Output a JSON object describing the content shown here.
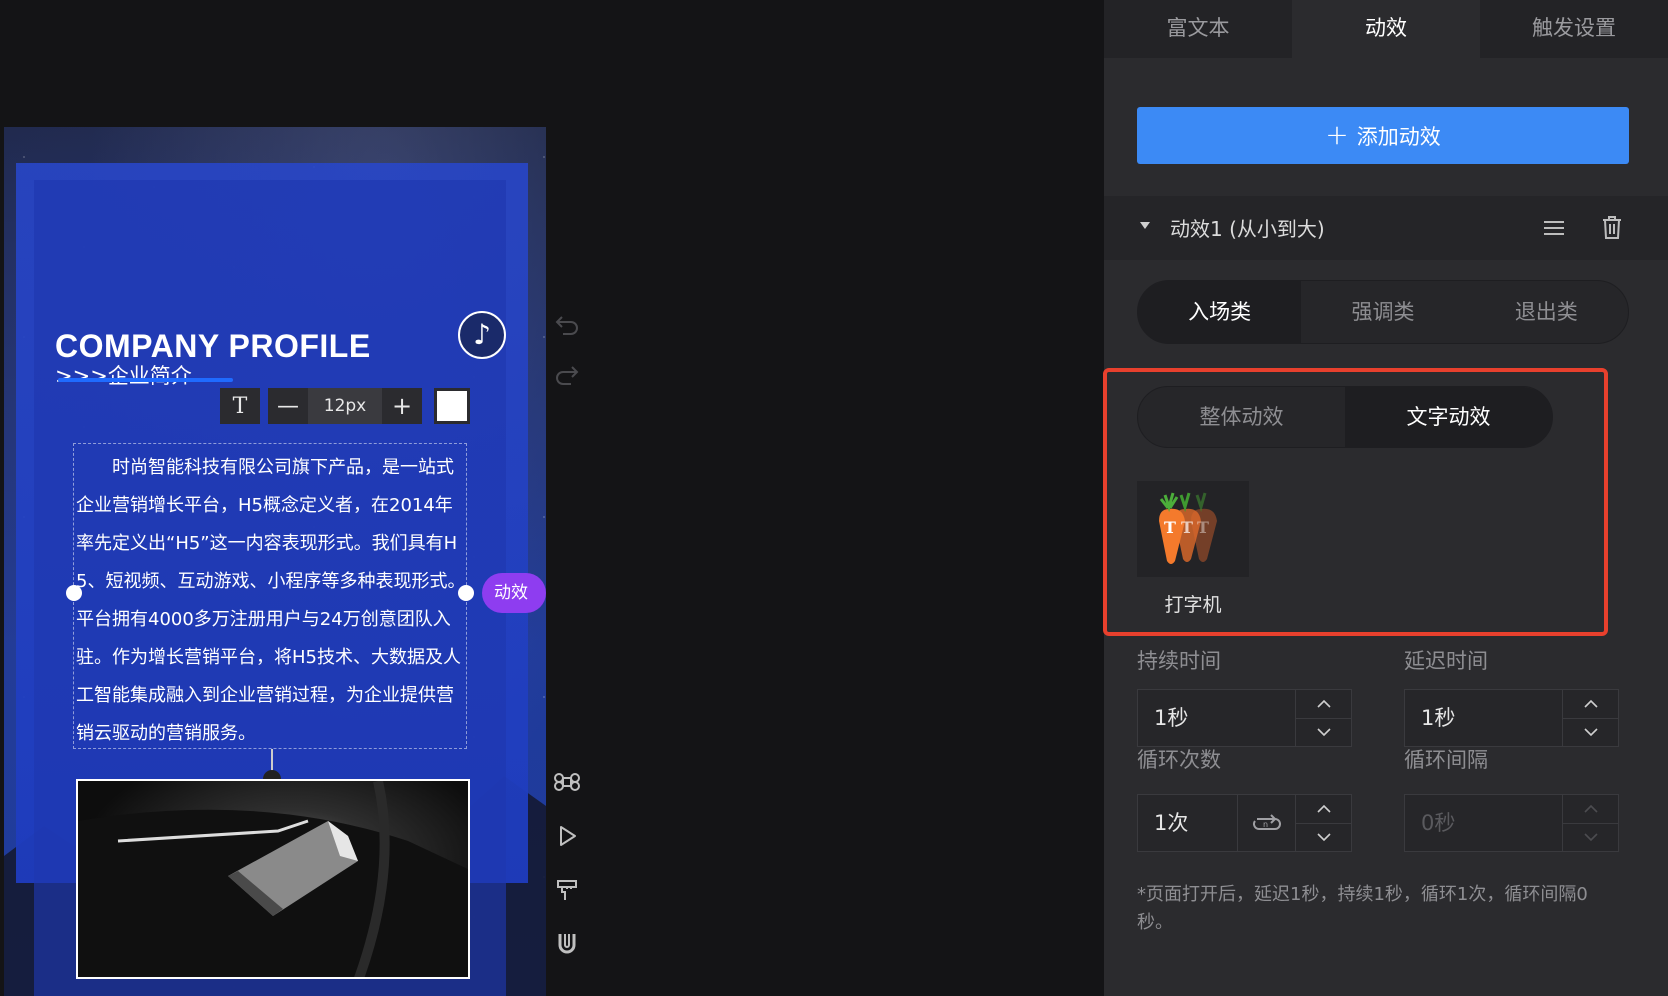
{
  "canvas": {
    "title": "COMPANY PROFILE",
    "subtitle": ">>>企业简介",
    "body_text": "时尚智能科技有限公司旗下产品，是一站式企业营销增长平台，H5概念定义者，在2014年率先定义出“H5”这一内容表现形式。我们具有H5、短视频、互动游戏、小程序等多种表现形式。平台拥有4000多万注册用户与24万创意团队入驻。作为增长营销平台，将H5技术、大数据及人工智能集成融入到企业营销过程，为企业提供营销云驱动的营销服务。",
    "anim_badge": "动效",
    "music_icon": "music-note-icon"
  },
  "text_toolbar": {
    "font_button": "T",
    "minus": "—",
    "font_size": "12px",
    "plus": "+",
    "color": "#ffffff"
  },
  "tools": [
    "undo-icon",
    "redo-icon",
    "command-icon",
    "play-icon",
    "format-painter-icon",
    "magnet-icon"
  ],
  "panel": {
    "tabs": [
      {
        "label": "富文本",
        "active": false
      },
      {
        "label": "动效",
        "active": true
      },
      {
        "label": "触发设置",
        "active": false
      }
    ],
    "add_button": "添加动效",
    "animation_title": "动效1 (从小到大)",
    "category_tabs": [
      {
        "label": "入场类",
        "active": true
      },
      {
        "label": "强调类",
        "active": false
      },
      {
        "label": "退出类",
        "active": false
      }
    ],
    "type_tabs": [
      {
        "label": "整体动效",
        "active": false
      },
      {
        "label": "文字动效",
        "active": true
      }
    ],
    "effect": {
      "label": "打字机",
      "icon": "typewriter-carrot-icon"
    },
    "duration": {
      "label": "持续时间",
      "value": "1秒"
    },
    "delay": {
      "label": "延迟时间",
      "value": "1秒"
    },
    "loop_count": {
      "label": "循环次数",
      "value": "1次"
    },
    "loop_interval": {
      "label": "循环间隔",
      "value": "0秒"
    },
    "note": "*页面打开后，延迟1秒，持续1秒，循环1次，循环间隔0秒。",
    "highlight_color": "#e8402d",
    "accent": "#3c8af5"
  }
}
